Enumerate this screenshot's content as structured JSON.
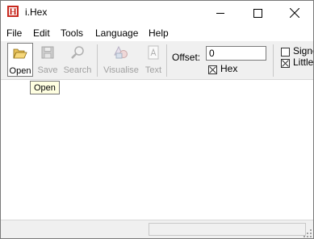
{
  "window": {
    "title": "i.Hex",
    "app_icon_letter": "H"
  },
  "menubar": {
    "items": [
      "File",
      "Edit",
      "Tools",
      "Language",
      "Help"
    ]
  },
  "toolbar": {
    "open_label": "Open",
    "save_label": "Save",
    "search_label": "Search",
    "visualise_label": "Visualise",
    "text_label": "Text",
    "offset_label": "Offset:",
    "offset_value": "0",
    "hex_label": "Hex",
    "hex_checked": true,
    "signed_label": "Signed",
    "signed_checked": false,
    "little_label": "Little endian",
    "little_checked": true
  },
  "tooltip": {
    "text": "Open"
  },
  "status": {
    "panel_text": ""
  }
}
